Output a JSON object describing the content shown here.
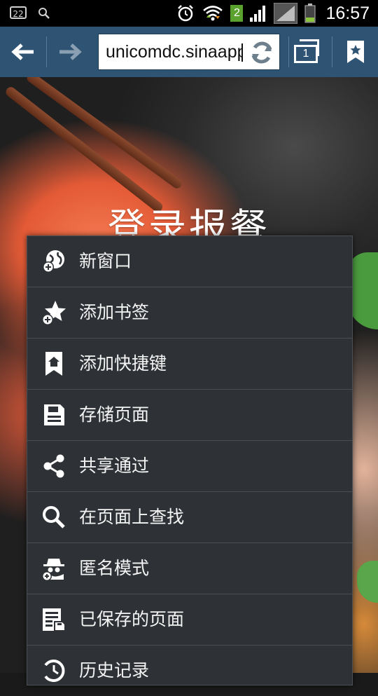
{
  "status_bar": {
    "notification_count": "22",
    "sim_badge": "2",
    "time": "16:57"
  },
  "toolbar": {
    "url": "unicomdc.sinaapp.com",
    "tab_count": "1"
  },
  "page": {
    "hero_title": "登录报餐"
  },
  "menu": {
    "items": [
      {
        "label": "新窗口",
        "icon": "new-window-icon"
      },
      {
        "label": "添加书签",
        "icon": "add-bookmark-icon"
      },
      {
        "label": "添加快捷键",
        "icon": "add-shortcut-icon"
      },
      {
        "label": "存储页面",
        "icon": "save-page-icon"
      },
      {
        "label": "共享通过",
        "icon": "share-icon"
      },
      {
        "label": "在页面上查找",
        "icon": "find-icon"
      },
      {
        "label": "匿名模式",
        "icon": "incognito-icon"
      },
      {
        "label": "已保存的页面",
        "icon": "saved-pages-icon"
      },
      {
        "label": "历史记录",
        "icon": "history-icon"
      }
    ]
  },
  "colors": {
    "toolbar": "#2f5373",
    "menu_bg": "#2e3236",
    "statusbar": "#000000"
  }
}
